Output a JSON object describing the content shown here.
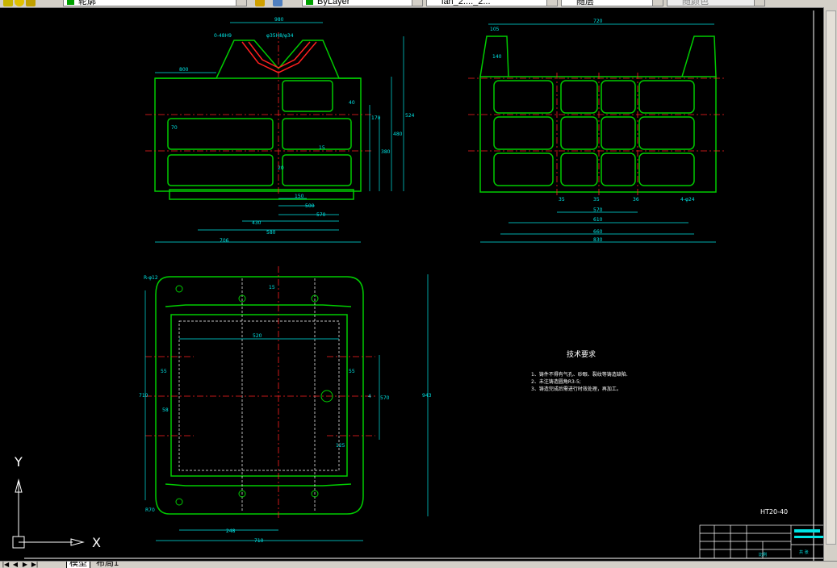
{
  "toolbar": {
    "layer_name": "轮廓",
    "color_label": "ByLayer",
    "linetype_label": "lan_2...._2...",
    "lineweight_label": "随层",
    "plotstyle_label": "随颜色"
  },
  "layout_tabs": {
    "model": "模型",
    "layout1": "布局1"
  },
  "ucs": {
    "y_label": "Y",
    "x_label": "X"
  },
  "drawing": {
    "front_view": {
      "dims_top": [
        "980",
        "0-48H9",
        "φ35H8/φ34",
        "800"
      ],
      "dims_right": [
        "40",
        "170",
        "380",
        "480",
        "524"
      ],
      "dims_bottom": [
        "150",
        "500",
        "570",
        "430",
        "580",
        "706"
      ],
      "dims_left": [
        "70"
      ],
      "dims_inner": [
        "15",
        "20"
      ]
    },
    "side_view": {
      "dims_top": [
        "720",
        "105",
        "140"
      ],
      "dims_bottom": [
        "35",
        "35",
        "36",
        "4-φ24",
        "570",
        "610",
        "660",
        "830"
      ]
    },
    "plan_view": {
      "dims_top": [
        "R-φ12",
        "15",
        "520"
      ],
      "dims_left": [
        "55",
        "58",
        "710"
      ],
      "dims_right": [
        "55",
        "4",
        "570",
        "943",
        "125"
      ],
      "dims_bottom": [
        "R70",
        "248",
        "710"
      ]
    },
    "tech_req": {
      "title": "技术要求",
      "items": [
        "1、铸件不得有气孔、砂眼、裂纹等铸造缺陷.",
        "2、未注铸造圆角R3-5;",
        "3、铸造完成后需进行时效处理，再加工。"
      ]
    },
    "material": "HT20-40",
    "title_block": {
      "label_a": "比例",
      "label_b": "共  张"
    }
  },
  "colors": {
    "outline": "#00cc00",
    "dimension": "#00e5e5",
    "centerline": "#ff2020",
    "hidden": "#ffffff",
    "highlight": "#ff3030"
  }
}
